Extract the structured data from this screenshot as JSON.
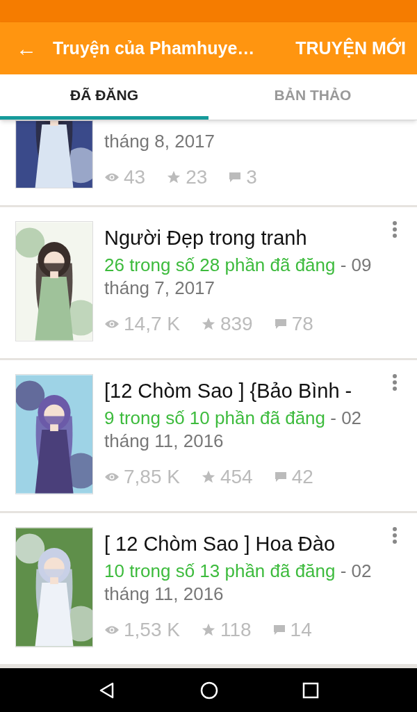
{
  "app_bar": {
    "back": "←",
    "title": "Truyện của Phamhuye…",
    "action": "TRUYỆN MỚI"
  },
  "tabs": [
    {
      "label": "ĐÃ ĐĂNG",
      "selected": true
    },
    {
      "label": "BẢN THẢO",
      "selected": false
    }
  ],
  "stories": [
    {
      "date": "tháng 8, 2017",
      "reads": "43",
      "votes": "23",
      "comments": "3"
    },
    {
      "title": "Người Đẹp trong tranh",
      "parts": "26 trong số 28 phần đã đăng",
      "date": " - 09 tháng 7, 2017",
      "reads": "14,7 K",
      "votes": "839",
      "comments": "78"
    },
    {
      "title": "[12 Chòm Sao ] {Bảo Bình -",
      "parts": "9 trong số 10 phần đã đăng",
      "date": " - 02 tháng 11, 2016",
      "reads": "7,85 K",
      "votes": "454",
      "comments": "42"
    },
    {
      "title": "[ 12 Chòm Sao ] Hoa Đào",
      "parts": "10 trong số 13 phần đã đăng",
      "date": " - 02 tháng 11, 2016",
      "reads": "1,53 K",
      "votes": "118",
      "comments": "14"
    }
  ]
}
